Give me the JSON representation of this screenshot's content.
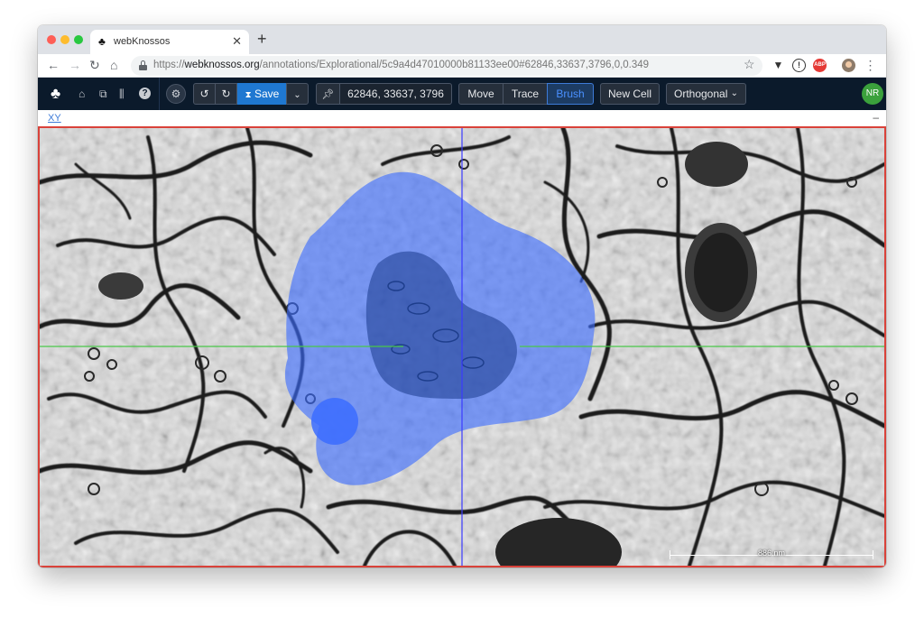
{
  "browser": {
    "tab_title": "webKnossos",
    "url_scheme": "https://",
    "url_host": "webknossos.org",
    "url_path": "/annotations/Explorational/5c9a4d47010000b81133ee00#62846,33637,3796,0,0.349"
  },
  "toolbar": {
    "save_label": "Save",
    "position": "62846, 33637, 3796",
    "tools": [
      "Move",
      "Trace",
      "Brush"
    ],
    "active_tool": "Brush",
    "new_cell_label": "New Cell",
    "view_mode": "Orthogonal",
    "user_initials": "NR"
  },
  "viewport": {
    "plane_label": "XY",
    "minimize_label": "–",
    "scale_label": "886 nm"
  },
  "colors": {
    "toolbar_bg": "#0b1a2b",
    "accent": "#1f78d1",
    "segmentation": "#3b6cff",
    "viewport_border": "#d9423a",
    "crosshair_vertical": "#3a3aff",
    "crosshair_horizontal": "#49c749"
  },
  "icons": [
    "webknossos-logo-icon",
    "home-icon",
    "datasets-icon",
    "statistics-icon",
    "help-icon",
    "settings-icon",
    "undo-icon",
    "redo-icon",
    "hourglass-icon",
    "chevron-down-icon",
    "pin-icon"
  ]
}
